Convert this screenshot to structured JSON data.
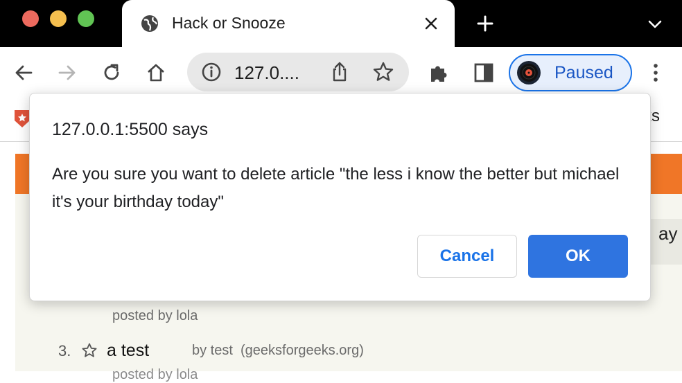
{
  "browser": {
    "tab": {
      "title": "Hack or Snooze"
    },
    "address": {
      "url": "127.0...."
    },
    "profile": {
      "label": "Paused"
    },
    "bookmarks": {
      "right_label_fragment": "rks"
    },
    "icons": [
      "back-icon",
      "forward-icon",
      "reload-icon",
      "home-icon",
      "site-info-icon",
      "share-icon",
      "bookmark-star-icon",
      "extensions-icon",
      "side-panel-icon",
      "more-icon",
      "globe-icon",
      "close-icon",
      "new-tab-icon",
      "tab-search-icon"
    ]
  },
  "page": {
    "partial_text": "ay",
    "posted_by": "posted by lola",
    "story": {
      "number": "3.",
      "title": "a test",
      "byline": "by test",
      "host": "(geeksforgeeks.org)"
    },
    "clipped_line": "posted by lola"
  },
  "dialog": {
    "title": "127.0.0.1:5500 says",
    "message": "Are you sure you want to delete article \"the less i know the better but michael it's your birthday today\"",
    "cancel_label": "Cancel",
    "ok_label": "OK"
  },
  "colors": {
    "accent": "#1a73e8",
    "ok_button": "#2f74e0",
    "header_orange": "#f07627",
    "page_bg": "#f6f6ef"
  }
}
